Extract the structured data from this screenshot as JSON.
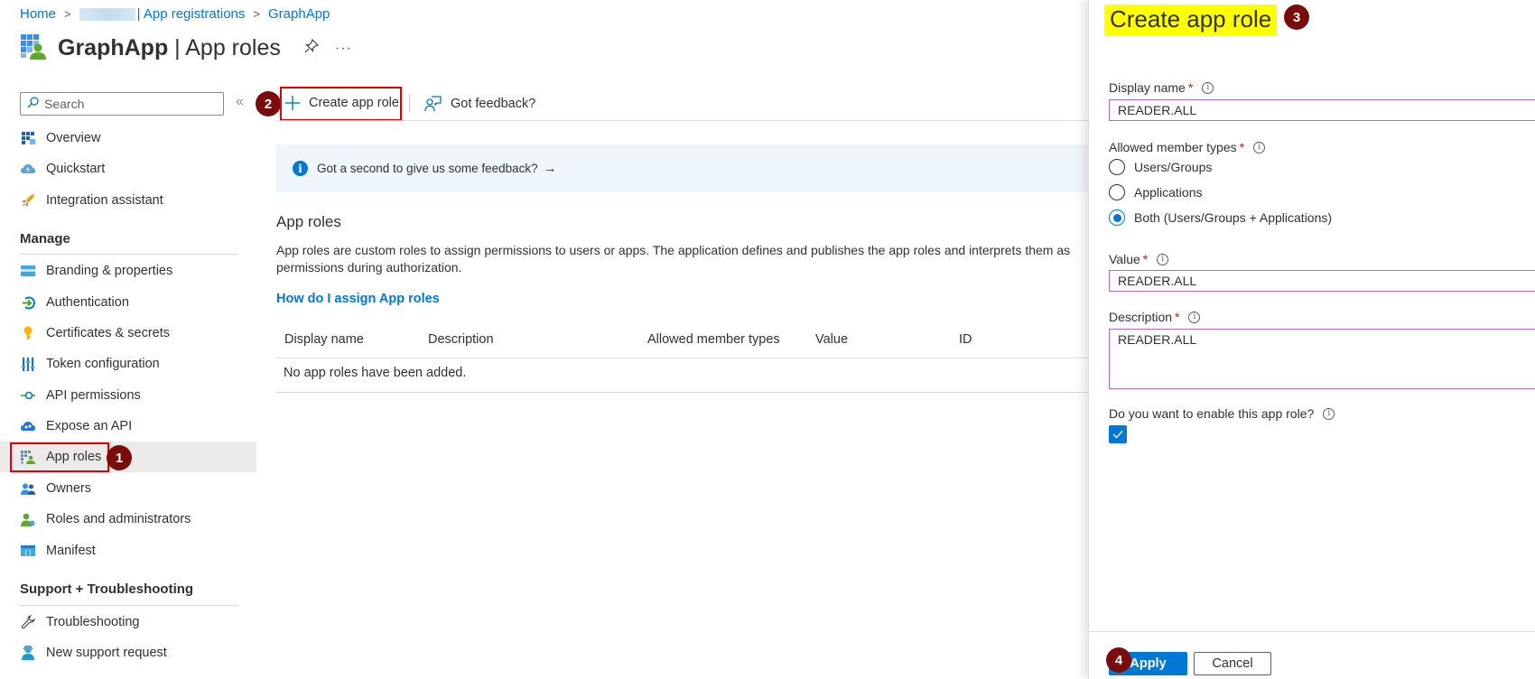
{
  "breadcrumb": {
    "items": [
      "Home",
      "| App registrations",
      "GraphApp"
    ],
    "separator": ">"
  },
  "header": {
    "app_name": "GraphApp",
    "divider": "|",
    "page": "App roles",
    "pin_icon": "pin-icon",
    "more_icon": "ellipsis-icon",
    "more_label": "···"
  },
  "sidebar": {
    "search_placeholder": "Search",
    "collapse_label": "«",
    "top_items": [
      {
        "label": "Overview",
        "icon": "overview-grid-icon"
      },
      {
        "label": "Quickstart",
        "icon": "quickstart-cloud-icon"
      },
      {
        "label": "Integration assistant",
        "icon": "rocket-icon"
      }
    ],
    "sections": [
      {
        "heading": "Manage",
        "items": [
          {
            "label": "Branding & properties",
            "icon": "branding-card-icon"
          },
          {
            "label": "Authentication",
            "icon": "authentication-arrow-icon"
          },
          {
            "label": "Certificates & secrets",
            "icon": "key-icon"
          },
          {
            "label": "Token configuration",
            "icon": "token-bars-icon"
          },
          {
            "label": "API permissions",
            "icon": "api-permissions-icon"
          },
          {
            "label": "Expose an API",
            "icon": "cloud-api-icon"
          },
          {
            "label": "App roles",
            "icon": "app-roles-icon",
            "active": true
          },
          {
            "label": "Owners",
            "icon": "owners-people-icon"
          },
          {
            "label": "Roles and administrators",
            "icon": "roles-admin-icon"
          },
          {
            "label": "Manifest",
            "icon": "manifest-braces-icon"
          }
        ]
      },
      {
        "heading": "Support + Troubleshooting",
        "items": [
          {
            "label": "Troubleshooting",
            "icon": "wrench-icon"
          },
          {
            "label": "New support request",
            "icon": "support-person-icon"
          }
        ]
      }
    ]
  },
  "toolbar": {
    "create_label": "Create app role",
    "feedback_label": "Got feedback?"
  },
  "infobar": {
    "text": "Got a second to give us some feedback?",
    "arrow": "→"
  },
  "main": {
    "section_title": "App roles",
    "description": "App roles are custom roles to assign permissions to users or apps. The application defines and publishes the app roles and interprets them as permissions during authorization.",
    "howto_link": "How do I assign App roles",
    "table": {
      "columns": [
        "Display name",
        "Description",
        "Allowed member types",
        "Value",
        "ID"
      ],
      "empty_text": "No app roles have been added."
    }
  },
  "annotations": {
    "badges": [
      "1",
      "2",
      "3",
      "4"
    ],
    "badge_color": "#7b0c0c",
    "box_color": "#e50000",
    "highlight_color": "#ffff00"
  },
  "panel": {
    "title": "Create app role",
    "display_name": {
      "label": "Display name",
      "required": "*",
      "value": "READER.ALL"
    },
    "member_types": {
      "label": "Allowed member types",
      "required": "*",
      "options": [
        "Users/Groups",
        "Applications",
        "Both (Users/Groups + Applications)"
      ],
      "selected": "Both (Users/Groups + Applications)"
    },
    "value": {
      "label": "Value",
      "required": "*",
      "value": "READER.ALL"
    },
    "description": {
      "label": "Description",
      "required": "*",
      "value": "READER.ALL"
    },
    "enable": {
      "label": "Do you want to enable this app role?",
      "checked": true
    },
    "apply_label": "Apply",
    "cancel_label": "Cancel",
    "info_glyph": "i"
  },
  "colors": {
    "accent": "#0078d4",
    "input_focus_border": "#b86cc9",
    "required": "#a4262c",
    "active_nav_bg": "#edebe9"
  }
}
